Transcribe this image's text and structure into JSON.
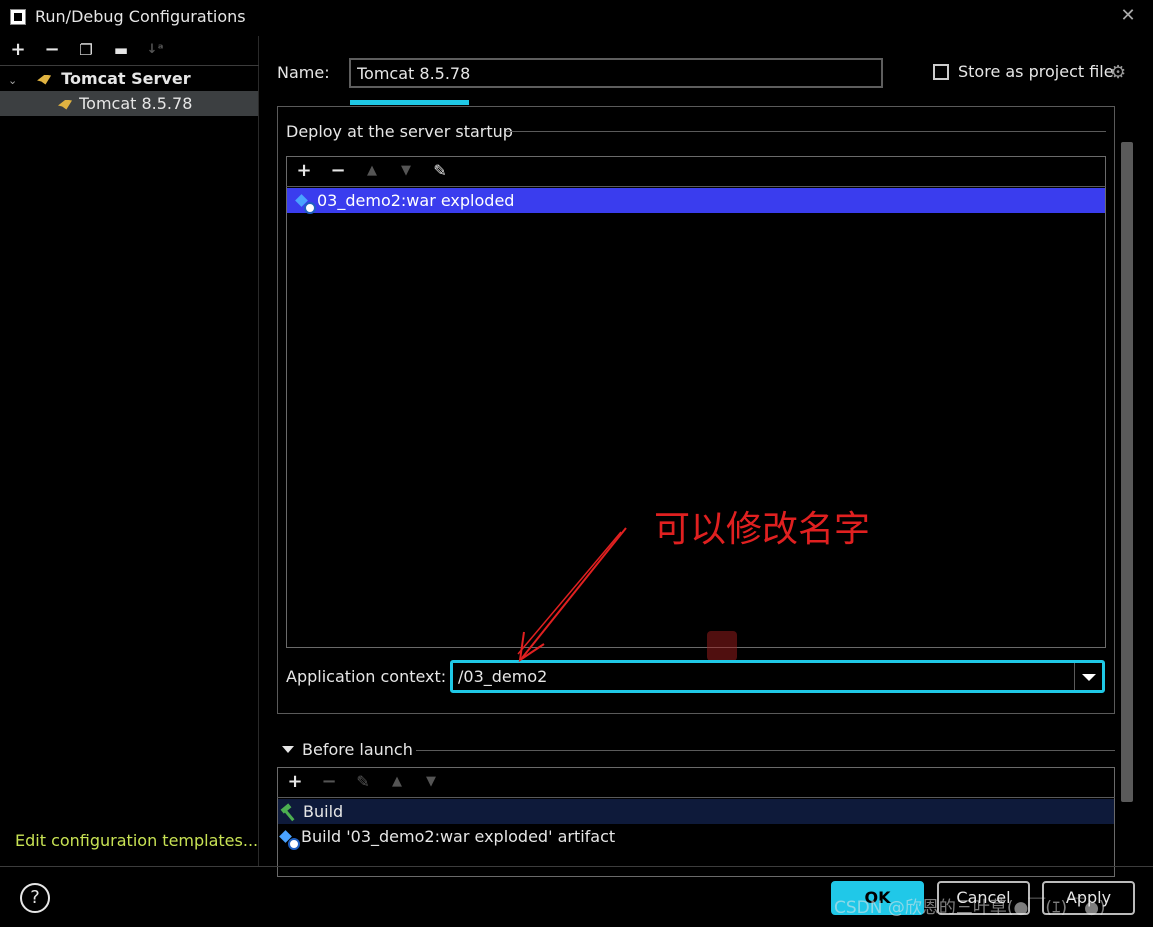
{
  "window": {
    "title": "Run/Debug Configurations",
    "close_icon": "close-icon"
  },
  "left_toolbar": {
    "icons": [
      "add-icon",
      "remove-icon",
      "copy-icon",
      "folder-add-icon",
      "sort-icon"
    ]
  },
  "tree": {
    "group_label": "Tomcat Server",
    "child_label": "Tomcat 8.5.78"
  },
  "edit_templates_link": "Edit configuration templates...",
  "name_field": {
    "label": "Name:",
    "value": "Tomcat 8.5.78"
  },
  "store_as_project": {
    "label": "Store as project file",
    "checked": false
  },
  "deploy": {
    "title": "Deploy at the server startup",
    "items": [
      "03_demo2:war exploded"
    ],
    "selected_color": "#3a3dee"
  },
  "app_context": {
    "label": "Application context:",
    "value": "/03_demo2"
  },
  "before_launch": {
    "title": "Before launch",
    "items": [
      "Build",
      "Build '03_demo2:war exploded' artifact"
    ]
  },
  "footer": {
    "help_label": "?",
    "ok_label": "OK",
    "cancel_label": "Cancel",
    "apply_label": "Apply",
    "watermark": "CSDN @欣恩的三叶草(●￣(ｴ)￣●)"
  },
  "annotation": {
    "text": "可以修改名字",
    "color": "#e02020"
  },
  "colors": {
    "accent": "#1fc8e6",
    "link": "#c8e254",
    "background": "#000000"
  }
}
